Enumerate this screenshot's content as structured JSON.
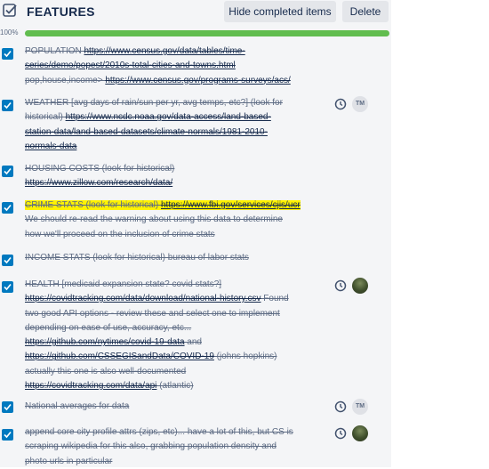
{
  "header": {
    "title": "FEATURES",
    "hide_label": "Hide completed items",
    "delete_label": "Delete",
    "icon": "checklist-icon"
  },
  "progress": {
    "label": "100%",
    "value": 1.0,
    "color": "#61bd4f"
  },
  "colors": {
    "checkbox": "#0079bf",
    "highlight": "#fff200",
    "panel": "#f4f5f7"
  },
  "items": [
    {
      "t1": "POPULATION ",
      "l1": "https://www.census.gov/data/tables/time-",
      "l2": "series/demo/popest/2010s-total-cities-and-towns.html",
      "t2": "pop,house,income> ",
      "l3": "https://www.census.gov/programs-surveys/acs/"
    },
    {
      "t1": "WEATHER [avg days of rain/sun per yr, avg temps, etc?] (look for",
      "t2": "historical) ",
      "l1": "https://www.ncdc.noaa.gov/data-access/land-based-",
      "l2": "station-data/land-based-datasets/climate-normals/1981-2010-",
      "l3": "normals-data",
      "avatar": "TM"
    },
    {
      "t1": "HOUSING COSTS (look for historical)",
      "l1": "https://www.zillow.com/research/data/"
    },
    {
      "t1": "CRIME STATS (look for historical) ",
      "l1": "https://www.fbi.gov/services/cjis/ucr",
      "t2": "We should re-read the warning about using this data to determine",
      "t3": "how we'll proceed on the inclusion of crime stats"
    },
    {
      "t1": "INCOME STATS (look for historical) bureau of labor stats"
    },
    {
      "t1": "HEALTH [medicaid expansion state? covid stats?]",
      "l1": "https://covidtracking.com/data/download/national-history.csv",
      "t2": " Found",
      "t3": "two good API options - review these and select one to implement",
      "t4": "depending on ease of use, accuracy, etc...",
      "l2": "https://github.com/nytimes/covid-19-data",
      "t5": " and",
      "l3": "https://github.com/CSSEGISandData/COVID-19",
      "t6": " (johns hopkins)",
      "t7": "actually this one is also well-documented",
      "l4": "https://covidtracking.com/data/api",
      "t8": " (atlantic)"
    },
    {
      "t1": "National averages for data",
      "avatar": "TM"
    },
    {
      "t1": "append core city profile attrs (zips, etc)... have a lot of this, but CS is",
      "t2": "scraping wikipedia for this also, grabbing population density and",
      "t3": "photo urls in particular"
    }
  ]
}
